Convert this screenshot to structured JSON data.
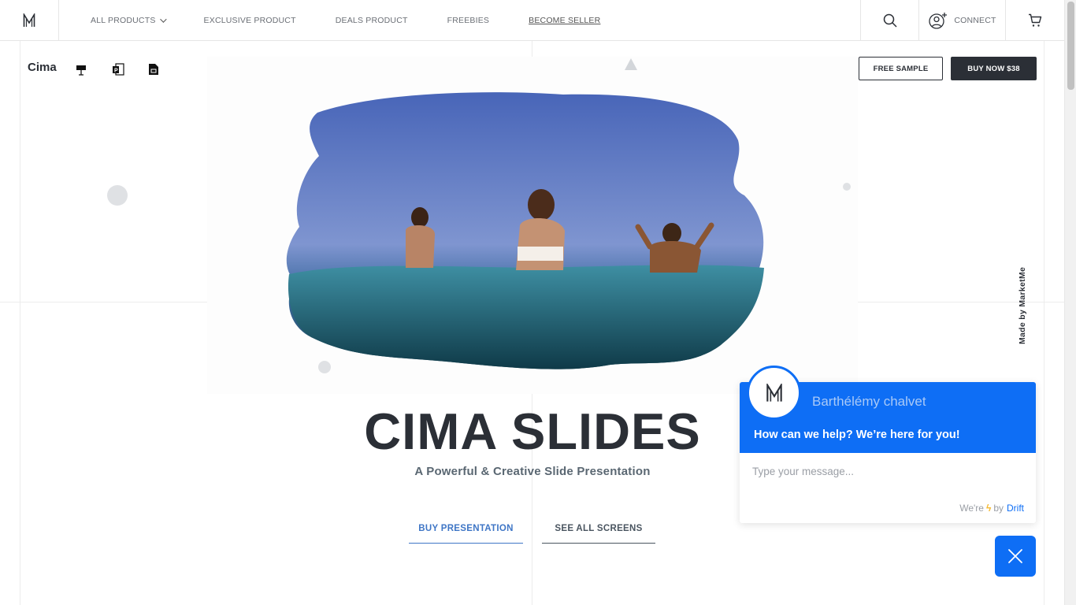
{
  "nav": {
    "links": [
      "ALL PRODUCTS",
      "EXCLUSIVE PRODUCT",
      "DEALS PRODUCT",
      "FREEBIES",
      "BECOME SELLER"
    ],
    "connect_label": "CONNECT"
  },
  "product": {
    "name": "Cima",
    "file_icons": [
      "keynote-icon",
      "powerpoint-icon",
      "google-slides-icon"
    ],
    "free_sample_label": "FREE SAMPLE",
    "buy_now_label": "BUY NOW $38"
  },
  "hero": {
    "title": "CIMA SLIDES",
    "subtitle": "A Powerful & Creative Slide Presentation",
    "buy_label": "BUY PRESENTATION",
    "see_label": "SEE ALL SCREENS"
  },
  "side_label": "Made by MarketMe",
  "chat": {
    "agent_name": "Barthélémy chalvet",
    "message": "How can we help? We’re here for you!",
    "input_placeholder": "Type your message...",
    "footer_prefix": "We're",
    "footer_by": "by",
    "footer_brand": "Drift"
  },
  "colors": {
    "accent_blue": "#0e6ef5",
    "dark": "#2b2f36",
    "link_blue": "#3f76c6"
  }
}
